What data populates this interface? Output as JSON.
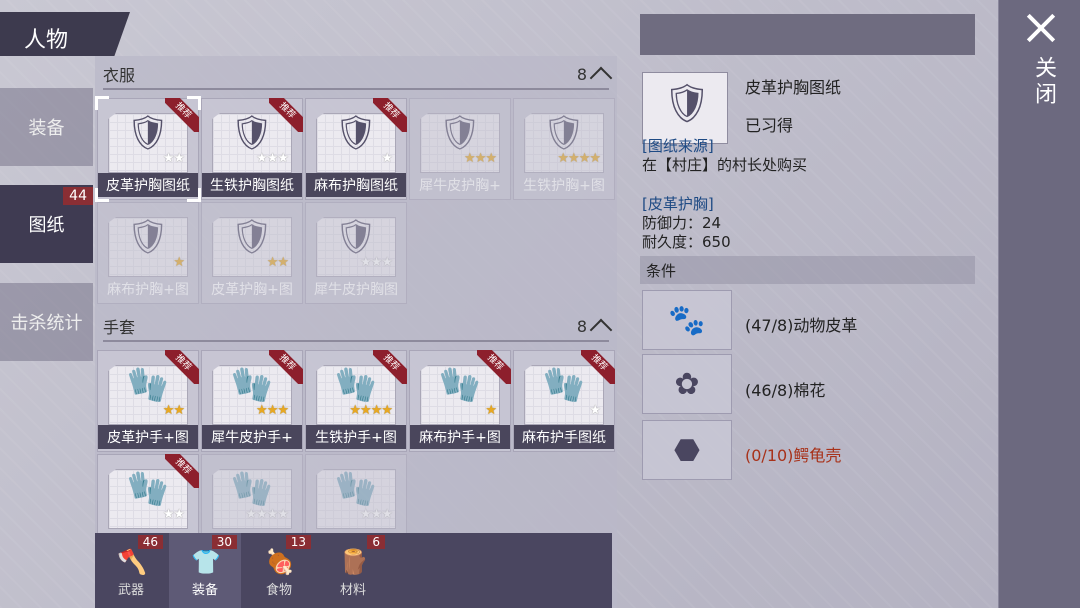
{
  "header": {
    "title": "人物"
  },
  "nav": [
    {
      "label": "装备",
      "badge": ""
    },
    {
      "label": "图纸",
      "badge": "44"
    },
    {
      "label": "击杀统计",
      "badge": ""
    }
  ],
  "sections": [
    {
      "title": "衣服",
      "count": "8",
      "items": [
        {
          "label": "皮革护胸图纸",
          "icon": "chestplate-icon",
          "stars": 2,
          "stars_on": 0,
          "ribbon": "推荐",
          "dim": false,
          "selected": true
        },
        {
          "label": "生铁护胸图纸",
          "icon": "chestplate-icon",
          "stars": 3,
          "stars_on": 0,
          "ribbon": "推荐",
          "dim": false,
          "selected": false
        },
        {
          "label": "麻布护胸图纸",
          "icon": "chestplate-icon",
          "stars": 1,
          "stars_on": 0,
          "ribbon": "推荐",
          "dim": false,
          "selected": false
        },
        {
          "label": "犀牛皮护胸+",
          "icon": "chestplate-icon",
          "stars": 3,
          "stars_on": 3,
          "ribbon": "",
          "dim": true,
          "selected": false
        },
        {
          "label": "生铁护胸+图",
          "icon": "chestplate-icon",
          "stars": 4,
          "stars_on": 4,
          "ribbon": "",
          "dim": true,
          "selected": false
        },
        {
          "label": "麻布护胸+图",
          "icon": "chestplate-icon",
          "stars": 1,
          "stars_on": 1,
          "ribbon": "",
          "dim": true,
          "selected": false
        },
        {
          "label": "皮革护胸+图",
          "icon": "chestplate-icon",
          "stars": 2,
          "stars_on": 2,
          "ribbon": "",
          "dim": true,
          "selected": false
        },
        {
          "label": "犀牛皮护胸图",
          "icon": "chestplate-icon",
          "stars": 3,
          "stars_on": 0,
          "ribbon": "",
          "dim": true,
          "selected": false
        }
      ]
    },
    {
      "title": "手套",
      "count": "8",
      "items": [
        {
          "label": "皮革护手+图",
          "icon": "glove-icon",
          "stars": 2,
          "stars_on": 2,
          "ribbon": "推荐",
          "dim": false,
          "selected": false
        },
        {
          "label": "犀牛皮护手+",
          "icon": "glove-icon",
          "stars": 3,
          "stars_on": 3,
          "ribbon": "推荐",
          "dim": false,
          "selected": false
        },
        {
          "label": "生铁护手+图",
          "icon": "glove-icon",
          "stars": 4,
          "stars_on": 4,
          "ribbon": "推荐",
          "dim": false,
          "selected": false
        },
        {
          "label": "麻布护手+图",
          "icon": "glove-icon",
          "stars": 1,
          "stars_on": 1,
          "ribbon": "推荐",
          "dim": false,
          "selected": false
        },
        {
          "label": "麻布护手图纸",
          "icon": "glove-icon",
          "stars": 1,
          "stars_on": 0,
          "ribbon": "推荐",
          "dim": false,
          "selected": false
        },
        {
          "label": "",
          "icon": "glove-icon",
          "stars": 2,
          "stars_on": 0,
          "ribbon": "推荐",
          "dim": false,
          "selected": false
        },
        {
          "label": "",
          "icon": "glove-icon",
          "stars": 4,
          "stars_on": 0,
          "ribbon": "",
          "dim": true,
          "selected": false
        },
        {
          "label": "",
          "icon": "glove-icon",
          "stars": 3,
          "stars_on": 0,
          "ribbon": "",
          "dim": true,
          "selected": false
        }
      ]
    }
  ],
  "tabs": [
    {
      "label": "武器",
      "badge": "46",
      "icon": "axe-icon"
    },
    {
      "label": "装备",
      "badge": "30",
      "icon": "shirt-icon"
    },
    {
      "label": "食物",
      "badge": "13",
      "icon": "food-icon"
    },
    {
      "label": "材料",
      "badge": "6",
      "icon": "material-icon"
    }
  ],
  "detail": {
    "name": "皮革护胸图纸",
    "status": "已习得",
    "source_title": "[图纸来源]",
    "source_text": "在【村庄】的村长处购买",
    "item_title": "[皮革护胸]",
    "defense": "防御力：24",
    "durability": "耐久度：650",
    "conditions_title": "条件",
    "materials": [
      {
        "text": "(47/8)动物皮革",
        "icon": "leather-icon",
        "ok": true
      },
      {
        "text": "(46/8)棉花",
        "icon": "cotton-icon",
        "ok": true
      },
      {
        "text": "(0/10)鳄龟壳",
        "icon": "turtle-shell-icon",
        "ok": false
      }
    ]
  },
  "close": {
    "label": "关闭"
  },
  "colors": {
    "accent": "#8a2e34",
    "star": "#e8a822",
    "link": "#1e4a84",
    "missing": "#a8321a"
  }
}
